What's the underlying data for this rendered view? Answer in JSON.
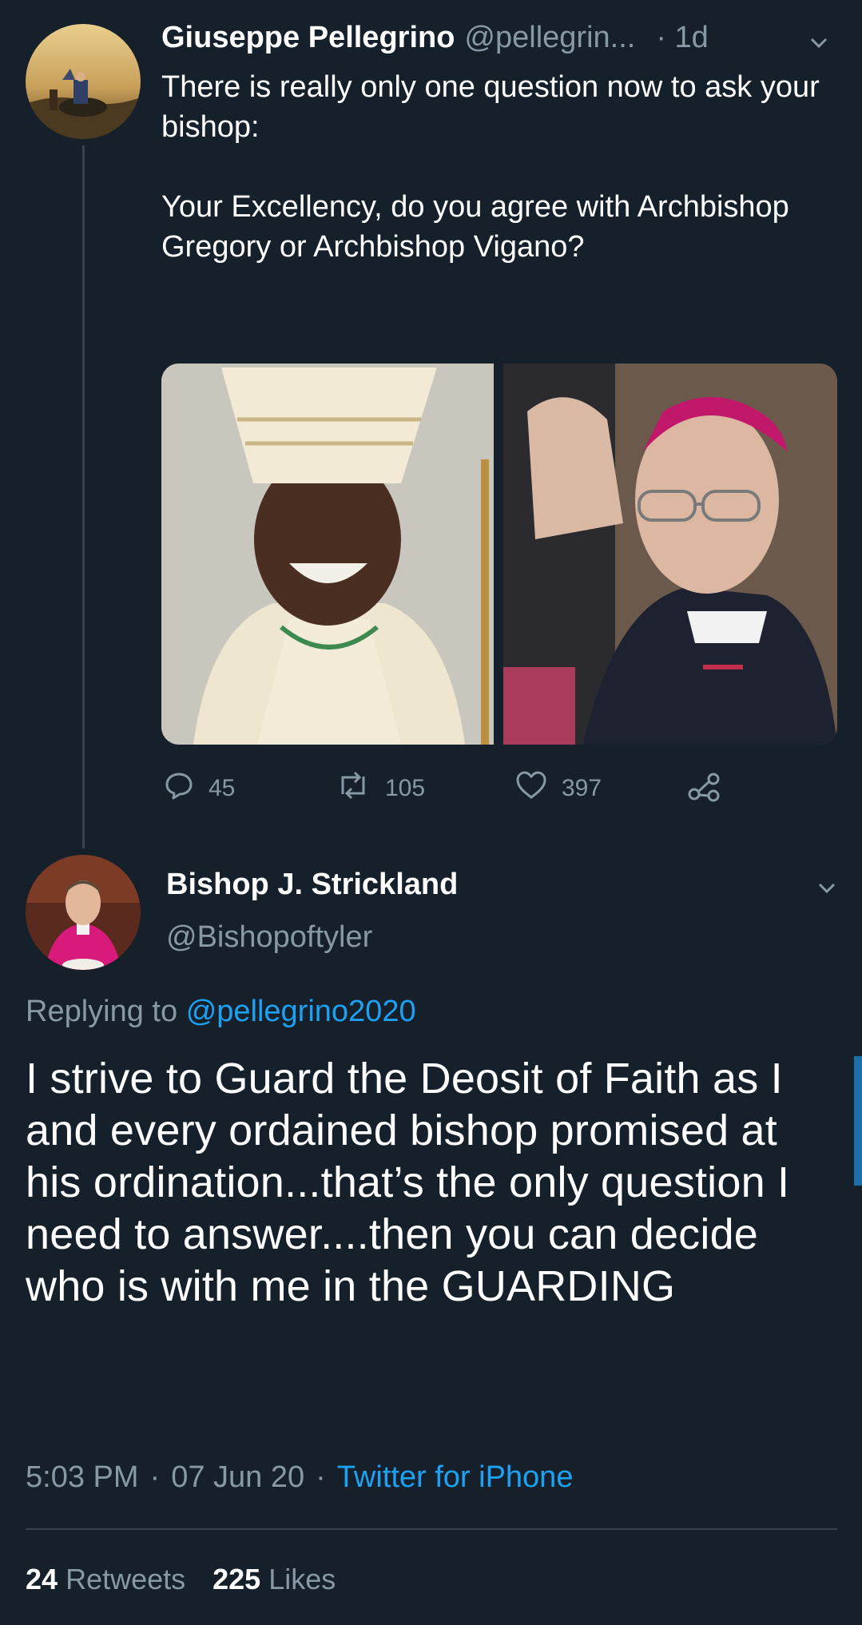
{
  "tweet1": {
    "author_name": "Giuseppe Pellegrino",
    "author_handle": "@pellegrin...",
    "age": "· 1d",
    "text": "There is really only one question now to ask your bishop:\n\nYour Excellency, do you agree with Archbishop Gregory or Archbishop Vigano?",
    "replies": "45",
    "retweets": "105",
    "likes": "397"
  },
  "tweet2": {
    "author_name": "Bishop J. Strickland",
    "author_handle": "@Bishopoftyler",
    "replying_label": "Replying to",
    "replying_handle": "@pellegrino2020",
    "text": "I strive to Guard the Deosit of Faith as I and every ordained bishop promised at his ordination...that’s the only question I need to answer....then you can decide who is with me in the GUARDING",
    "time": "5:03 PM",
    "date": "07 Jun 20",
    "source": "Twitter for iPhone",
    "sep": "·",
    "retweets_count": "24",
    "retweets_label": "Retweets",
    "likes_count": "225",
    "likes_label": "Likes"
  },
  "icons": [
    "reply-icon",
    "retweet-icon",
    "like-icon",
    "share-icon",
    "chevron-down-icon"
  ],
  "colors": {
    "background": "#15202b",
    "muted": "#8899a6",
    "link": "#1da1f2",
    "divider": "#38444d"
  }
}
